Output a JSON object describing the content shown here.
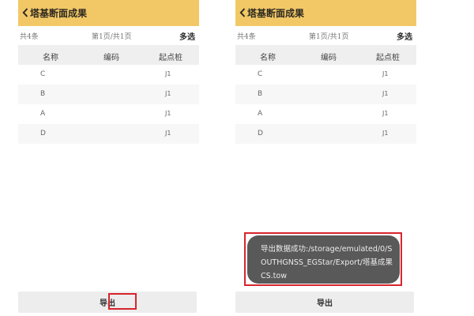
{
  "header": {
    "title": "塔基断面成果",
    "back_icon": "chevron-left-icon",
    "bg_color": "#f2c867"
  },
  "subbar": {
    "count": "共4条",
    "page_info": "第1页/共1页",
    "multi_select": "多选"
  },
  "table": {
    "headers": [
      "名称",
      "编码",
      "起点桩"
    ],
    "rows": [
      {
        "name": "C",
        "code": "",
        "pile": "J1"
      },
      {
        "name": "B",
        "code": "",
        "pile": "J1"
      },
      {
        "name": "A",
        "code": "",
        "pile": "J1"
      },
      {
        "name": "D",
        "code": "",
        "pile": "J1"
      }
    ]
  },
  "footer": {
    "export_label": "导出"
  },
  "toast": {
    "message": "导出数据成功:/storage/emulated/0/SOUTHGNSS_EGStar/Export/塔基成果CS.tow"
  },
  "highlight_color": "#d8242c"
}
